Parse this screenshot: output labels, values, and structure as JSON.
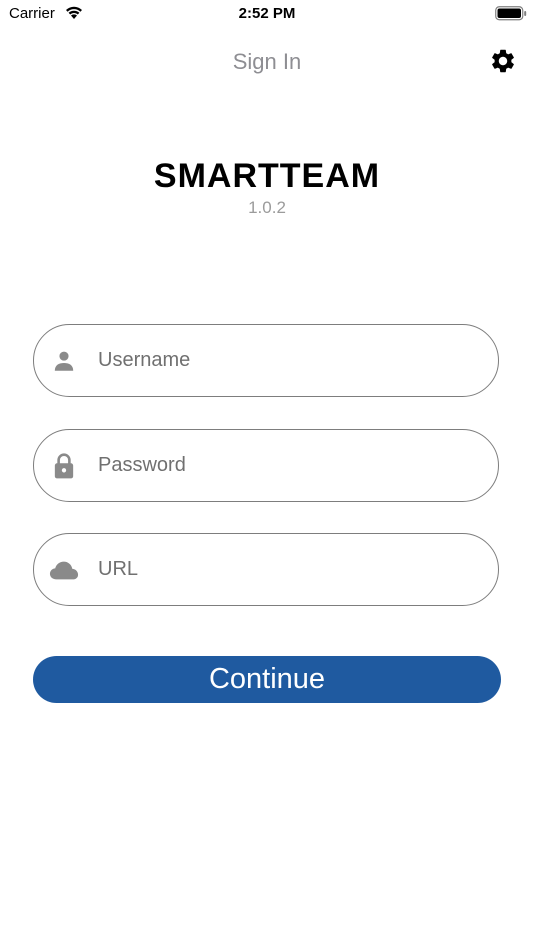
{
  "status_bar": {
    "carrier": "Carrier",
    "time": "2:52 PM",
    "wifi_icon": "wifi-icon",
    "battery_icon": "battery-icon"
  },
  "nav": {
    "title": "Sign In",
    "settings_icon": "gear-icon"
  },
  "brand": {
    "title": "SMARTTEAM",
    "version": "1.0.2"
  },
  "form": {
    "username": {
      "placeholder": "Username",
      "value": "",
      "icon": "user-icon"
    },
    "password": {
      "placeholder": "Password",
      "value": "",
      "icon": "lock-icon"
    },
    "url": {
      "placeholder": "URL",
      "value": "",
      "icon": "cloud-icon"
    }
  },
  "continue_button": {
    "label": "Continue"
  },
  "colors": {
    "accent": "#1f5aa0",
    "nav_title": "#8e8e93",
    "version": "#9b9b9b",
    "field_border": "#7d7d7d",
    "icon": "#8a8a8a"
  }
}
